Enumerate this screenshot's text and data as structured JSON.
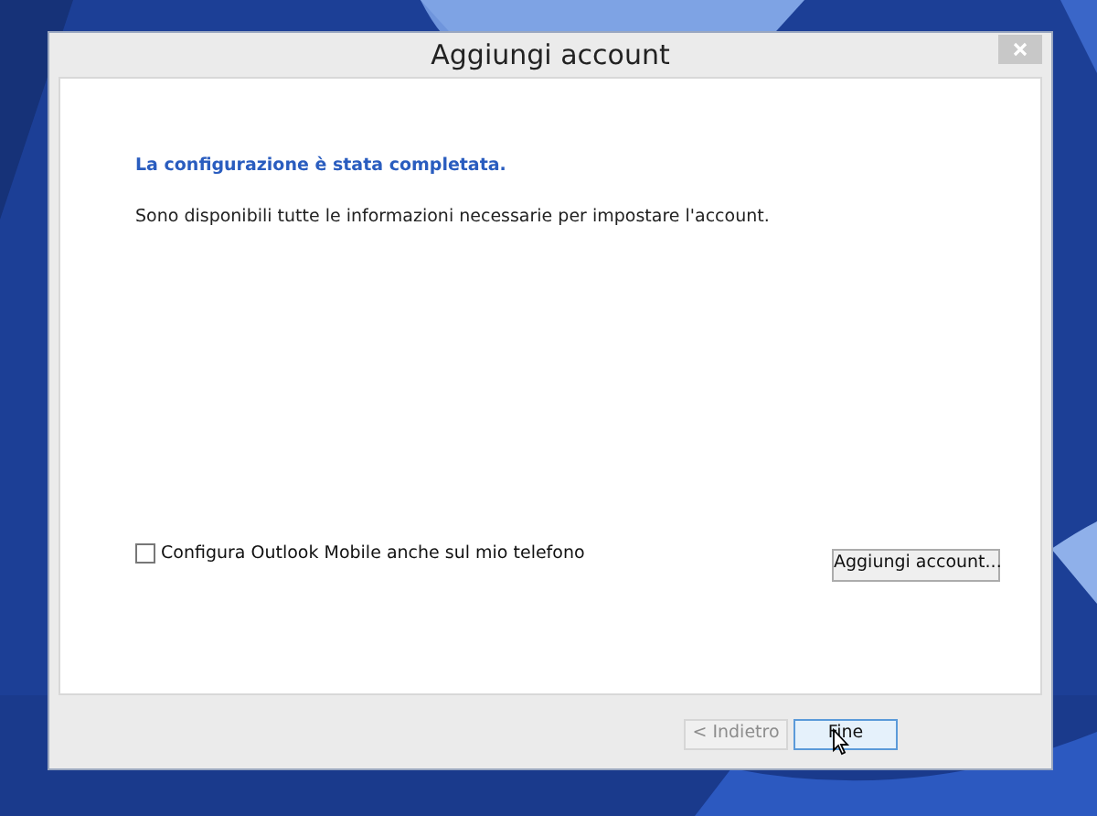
{
  "window": {
    "title": "Aggiungi account"
  },
  "heading": "La configurazione è stata completata.",
  "message": "Sono disponibili tutte le informazioni necessarie per impostare l'account.",
  "mobile_option": {
    "label": "Configura Outlook Mobile anche sul mio telefono",
    "checked": false
  },
  "add_account_button": "Aggiungi account...",
  "footer_buttons": [
    {
      "label": "< Indietro",
      "disabled": true,
      "focused": false
    },
    {
      "label": "Fine",
      "disabled": false,
      "focused": true
    }
  ]
}
